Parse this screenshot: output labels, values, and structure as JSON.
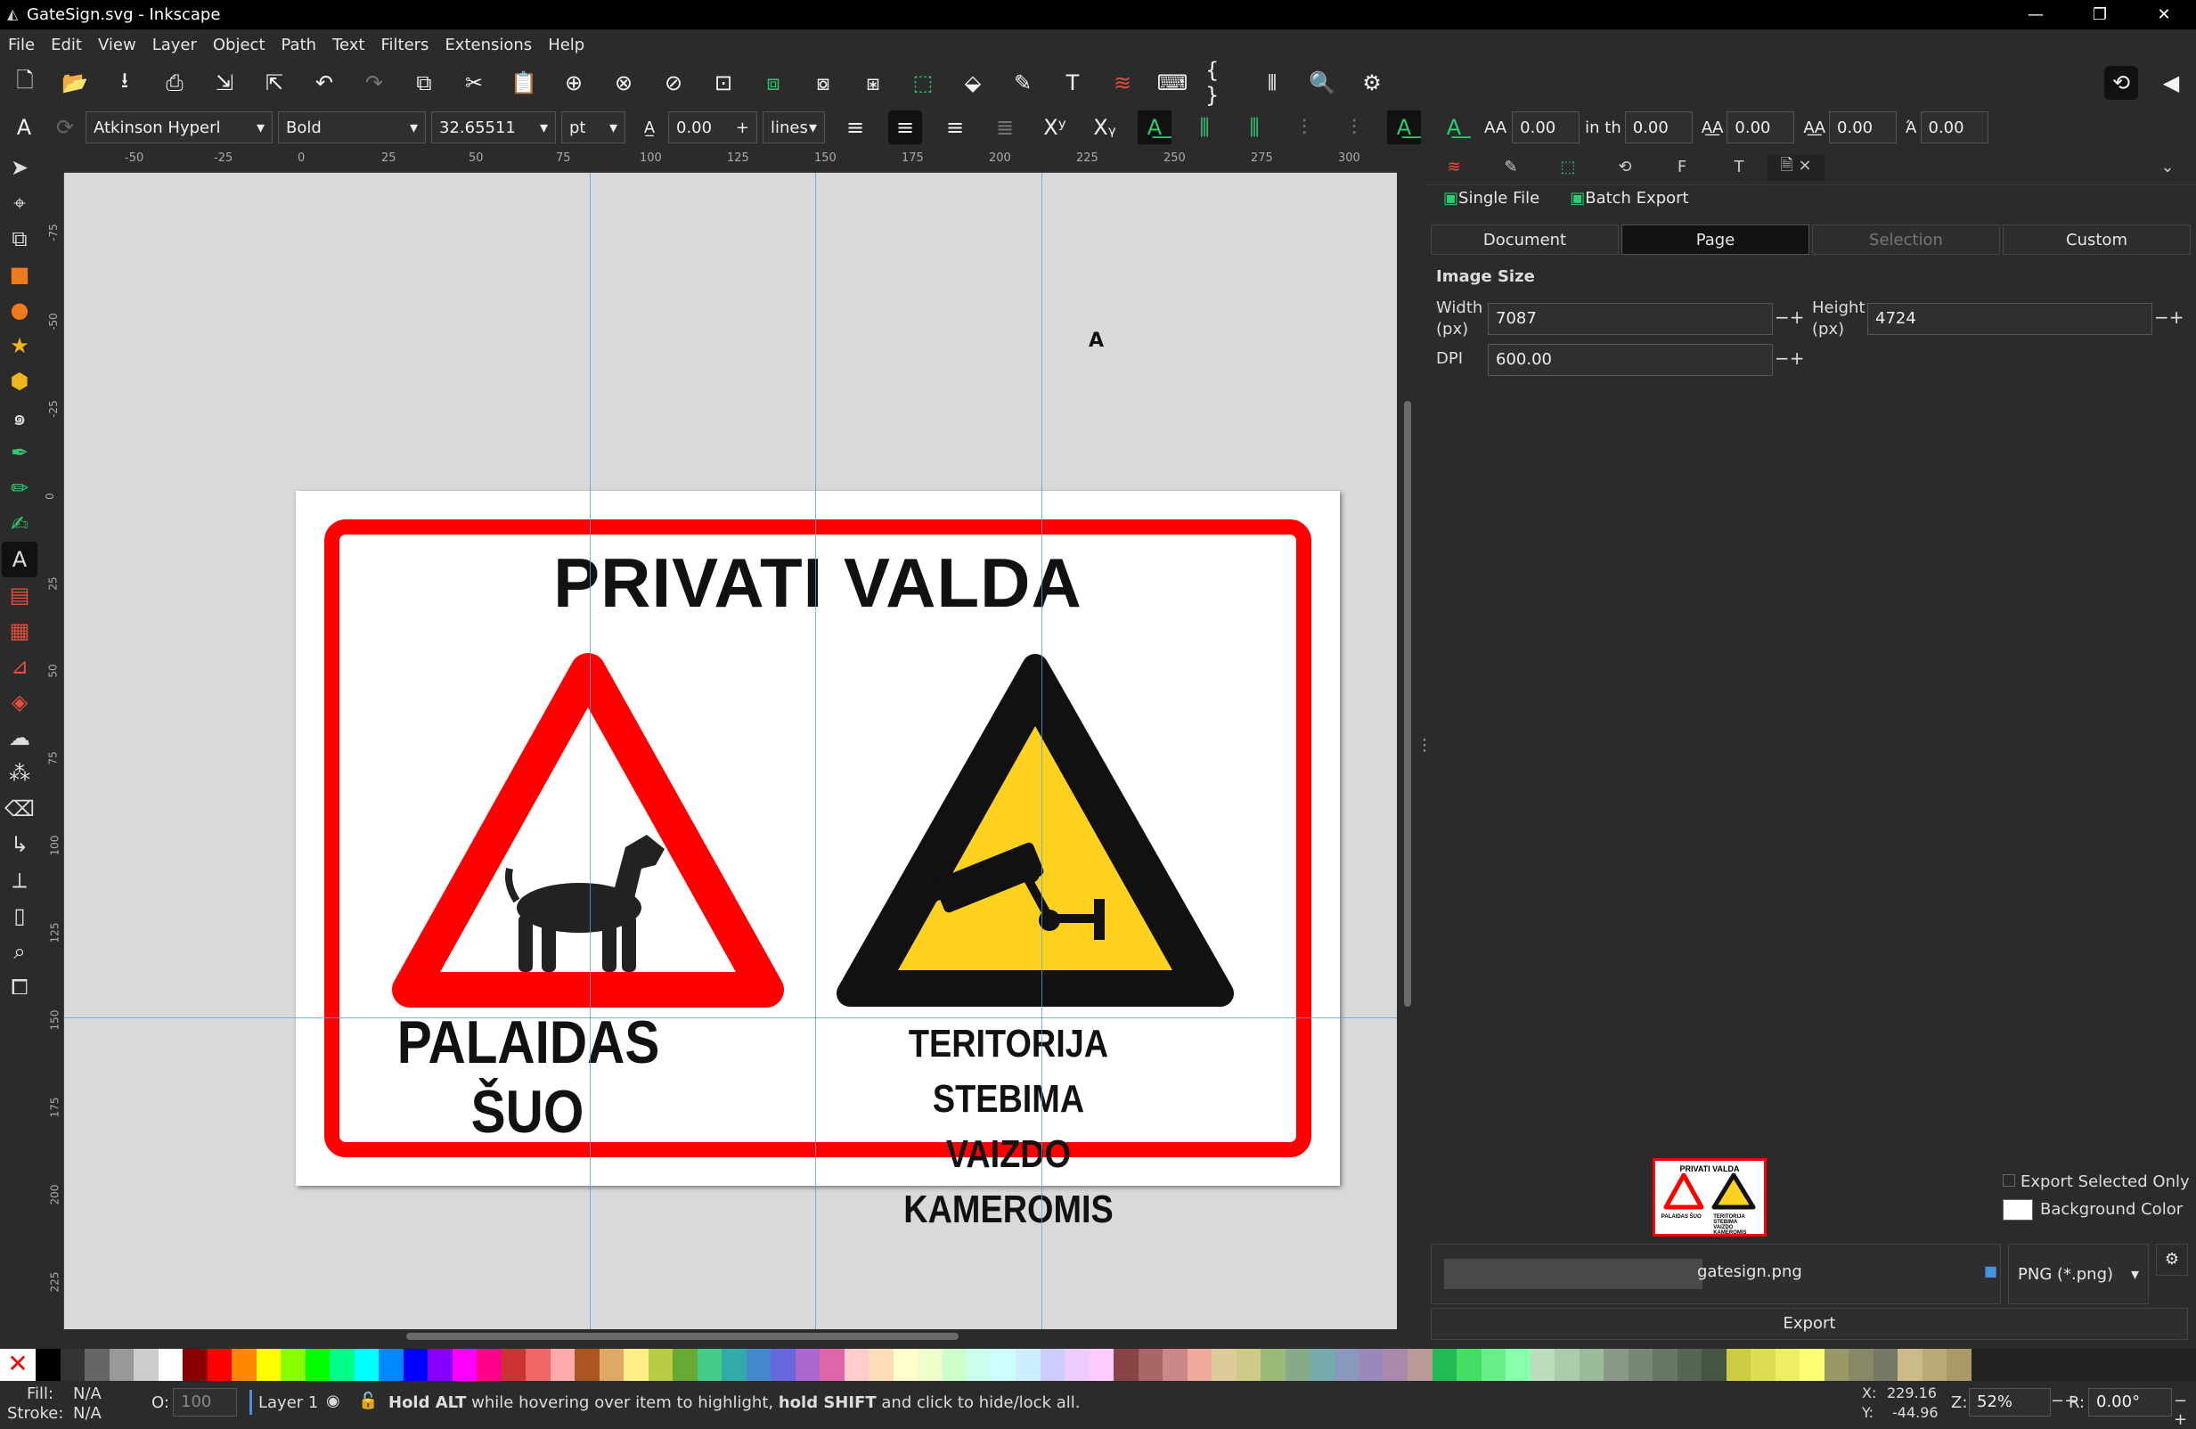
{
  "window": {
    "title": "GateSign.svg - Inkscape",
    "min": "—",
    "restore": "❐",
    "close": "✕"
  },
  "menu": [
    "File",
    "Edit",
    "View",
    "Layer",
    "Object",
    "Path",
    "Text",
    "Filters",
    "Extensions",
    "Help"
  ],
  "text_toolbar": {
    "font_family": "Atkinson Hyperl",
    "font_style": "Bold",
    "font_size": "32.65511",
    "unit": "pt",
    "line_height": "0.00",
    "line_unit": "lines",
    "letter_spacing": "0.00",
    "word_spacing_label": "in th",
    "word_spacing": "0.00",
    "kern1": "0.00",
    "kern2": "0.00",
    "rotation": "0.00"
  },
  "ruler_h_labels": [
    "-50",
    "-25",
    "0",
    "25",
    "50",
    "75",
    "100",
    "125",
    "150",
    "175",
    "200",
    "225",
    "250",
    "275",
    "300"
  ],
  "ruler_v_labels": [
    "-75",
    "-50",
    "-25",
    "0",
    "25",
    "50",
    "75",
    "100",
    "125",
    "150",
    "175",
    "200",
    "225"
  ],
  "sign": {
    "title": "PRIVATI VALDA",
    "left_caption": "PALAIDAS ŠUO",
    "right_caption_1": "TERITORIJA STEBIMA",
    "right_caption_2": "VAIZDO KAMEROMIS"
  },
  "export_panel": {
    "single_file": "Single File",
    "batch_export": "Batch Export",
    "modes": [
      "Document",
      "Page",
      "Selection",
      "Custom"
    ],
    "active_mode": "Page",
    "image_size": "Image Size",
    "width_label": "Width\n(px)",
    "width": "7087",
    "height_label": "Height\n(px)",
    "height": "4724",
    "dpi_label": "DPI",
    "dpi": "600.00",
    "export_selected_only": "Export Selected Only",
    "background_color": "Background Color",
    "filename": "gatesign.png",
    "format": "PNG (*.png)",
    "export_button": "Export",
    "thumb_title": "PRIVATI VALDA",
    "thumb_cap1": "PALAIDAS ŠUO",
    "thumb_cap2": "TERITORIJA STEBIMA VAIZDO KAMEROMIS"
  },
  "status": {
    "fill_label": "Fill:",
    "fill": "N/A",
    "stroke_label": "Stroke:",
    "stroke": "N/A",
    "opacity_label": "O:",
    "opacity": "100",
    "layer": "Layer 1",
    "hint_1": "Hold ALT",
    "hint_2": " while hovering over item to highlight, ",
    "hint_3": "hold SHIFT",
    "hint_4": " and click to hide/lock all.",
    "x_label": "X:",
    "x": "229.16",
    "y_label": "Y:",
    "y": "-44.96",
    "zoom_label": "Z:",
    "zoom": "52%",
    "rot_label": "R:",
    "rotation": "0.00°"
  },
  "colors": {
    "sign_red": "#ff0000",
    "warning_yellow": "#ffd21f",
    "accent_green": "#2ecc71"
  }
}
